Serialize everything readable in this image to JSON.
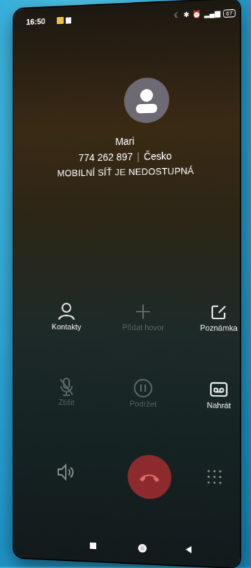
{
  "status_bar": {
    "time": "16:50",
    "battery": "67"
  },
  "caller": {
    "name": "Mari",
    "number": "774 262 897",
    "location": "Česko",
    "status": "MOBILNÍ SÍŤ JE NEDOSTUPNÁ"
  },
  "actions": [
    {
      "label": "Kontakty",
      "icon": "contact-icon",
      "enabled": true
    },
    {
      "label": "Přidat hovor",
      "icon": "add-call-icon",
      "enabled": false
    },
    {
      "label": "Poznámka",
      "icon": "note-icon",
      "enabled": true
    },
    {
      "label": "Ztišit",
      "icon": "mute-icon",
      "enabled": false
    },
    {
      "label": "Podržet",
      "icon": "hold-icon",
      "enabled": false
    },
    {
      "label": "Nahrát",
      "icon": "record-icon",
      "enabled": true
    }
  ],
  "bottom": {
    "speaker_icon": "speaker-icon",
    "end_call_icon": "end-call-icon",
    "dialpad_icon": "dialpad-icon"
  },
  "colors": {
    "end_call": "#8d2a2d",
    "background": "#2aa6d6"
  }
}
